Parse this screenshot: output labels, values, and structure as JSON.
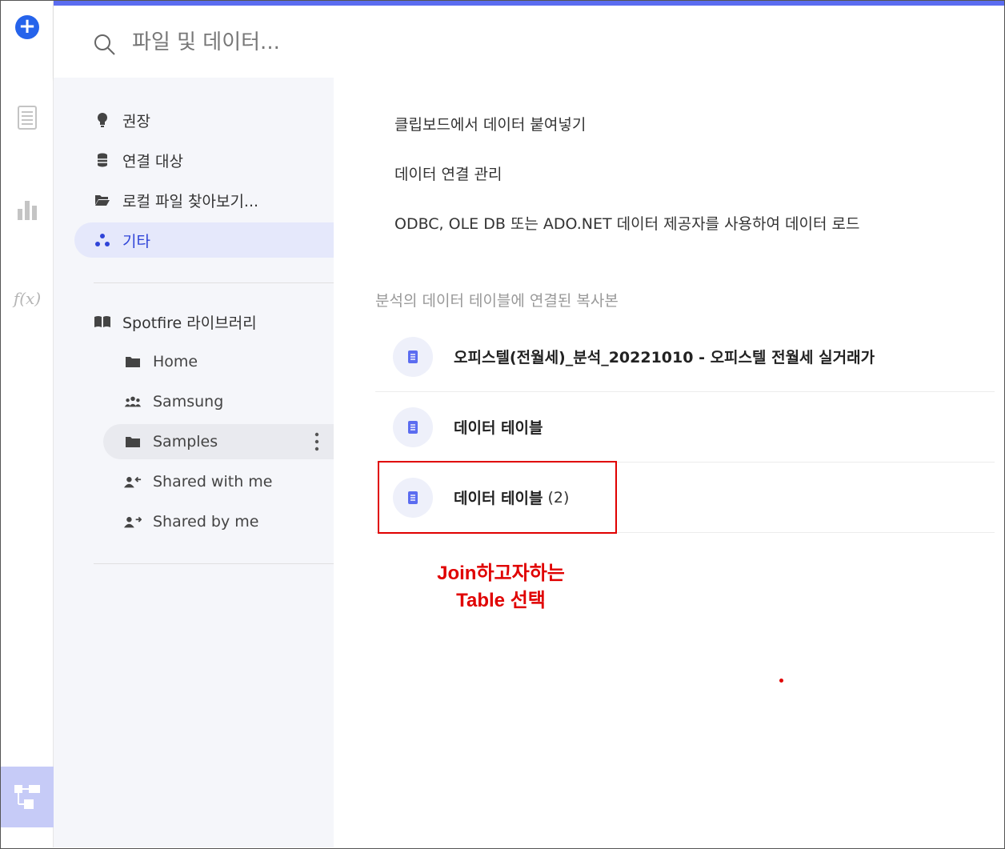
{
  "rail": {
    "add_icon": "plus-circle-icon",
    "doc_icon": "document-icon",
    "chart_icon": "bar-chart-icon",
    "fx_label": "f(x)",
    "flow_icon": "data-flow-icon",
    "accent": "#2563eb"
  },
  "search": {
    "placeholder": "파일 및 데이터..."
  },
  "nav": {
    "items": [
      {
        "label": "권장",
        "icon": "lightbulb-icon"
      },
      {
        "label": "연결 대상",
        "icon": "database-icon"
      },
      {
        "label": "로컬 파일 찾아보기...",
        "icon": "folder-open-icon"
      },
      {
        "label": "기타",
        "icon": "dots-cluster-icon",
        "active": true
      }
    ],
    "library": {
      "label": "Spotfire 라이브러리",
      "icon": "book-icon",
      "items": [
        {
          "label": "Home",
          "icon": "folder-icon"
        },
        {
          "label": "Samsung",
          "icon": "group-icon"
        },
        {
          "label": "Samples",
          "icon": "folder-icon",
          "selected": true
        },
        {
          "label": "Shared with me",
          "icon": "user-share-in-icon"
        },
        {
          "label": "Shared by me",
          "icon": "user-share-out-icon"
        }
      ]
    }
  },
  "main": {
    "actions": [
      "클립보드에서 데이터 붙여넣기",
      "데이터 연결 관리",
      "ODBC, OLE DB 또는 ADO.NET 데이터 제공자를 사용하여 데이터 로드"
    ],
    "section_title": "분석의 데이터 테이블에 연결된 복사본",
    "tables": [
      {
        "label": "오피스텔(전월세)_분석_20221010 - 오피스텔 전월세 실거래가",
        "suffix": ""
      },
      {
        "label": "데이터 테이블",
        "suffix": ""
      },
      {
        "label": "데이터 테이블",
        "suffix": "(2)"
      }
    ]
  },
  "annotation": {
    "line1": "Join하고자하는",
    "line2": "Table 선택",
    "color": "#e00000"
  }
}
